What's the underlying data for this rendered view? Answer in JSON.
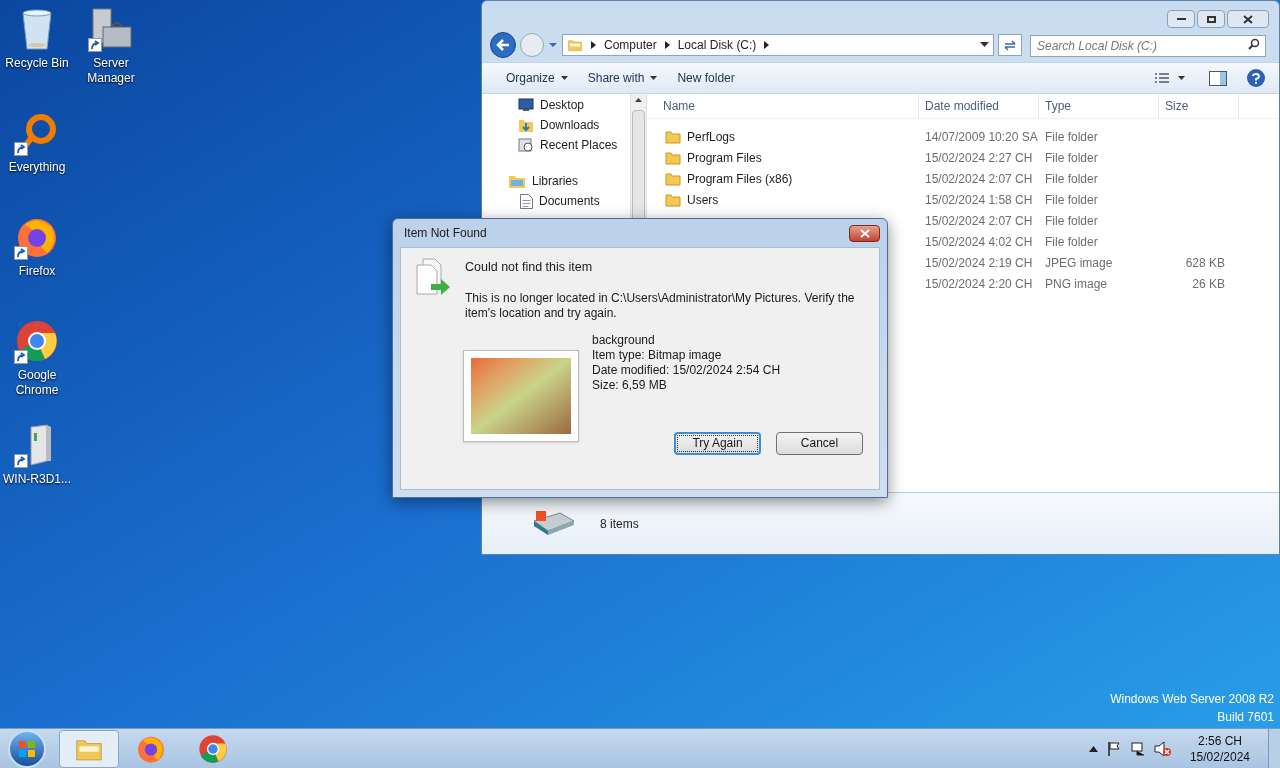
{
  "desktop_icons": [
    {
      "label": "Recycle Bin",
      "kind": "bin",
      "shortcut": false
    },
    {
      "label": "Server Manager",
      "kind": "server",
      "shortcut": true
    },
    {
      "label": "Everything",
      "kind": "everything",
      "shortcut": true
    },
    {
      "label": "Firefox",
      "kind": "firefox",
      "shortcut": true
    },
    {
      "label": "Google Chrome",
      "kind": "chrome",
      "shortcut": true
    },
    {
      "label": "WIN-R3D1...",
      "kind": "drive",
      "shortcut": true
    }
  ],
  "explorer": {
    "breadcrumbs": [
      "Computer",
      "Local Disk (C:)"
    ],
    "search": {
      "placeholder": "Search Local Disk (C:)"
    },
    "toolbar": [
      {
        "label": "Organize",
        "menu": true
      },
      {
        "label": "Share with",
        "menu": true
      },
      {
        "label": "New folder",
        "menu": false
      }
    ],
    "nav": [
      {
        "label": "Desktop",
        "kind": "desktop"
      },
      {
        "label": "Downloads",
        "kind": "downloads"
      },
      {
        "label": "Recent Places",
        "kind": "recent"
      },
      {
        "label": "Libraries",
        "kind": "libraries",
        "children": [
          {
            "label": "Documents",
            "kind": "documents"
          }
        ]
      }
    ],
    "columns": [
      "Name",
      "Date modified",
      "Type",
      "Size"
    ],
    "rows": [
      {
        "name": "PerfLogs",
        "date": "14/07/2009 10:20 SA",
        "type": "File folder"
      },
      {
        "name": "Program Files",
        "date": "15/02/2024 2:27 CH",
        "type": "File folder"
      },
      {
        "name": "Program Files (x86)",
        "date": "15/02/2024 2:07 CH",
        "type": "File folder"
      },
      {
        "name": "Users",
        "date": "15/02/2024 1:58 CH",
        "type": "File folder"
      },
      {
        "date": "15/02/2024 2:07 CH",
        "type": "File folder"
      },
      {
        "date": "15/02/2024 4:02 CH",
        "type": "File folder"
      },
      {
        "date": "15/02/2024 2:19 CH",
        "type": "JPEG image",
        "size": "628 KB"
      },
      {
        "date": "15/02/2024 2:20 CH",
        "type": "PNG image",
        "size": "26 KB"
      }
    ],
    "status": "8 items"
  },
  "dialog": {
    "title": "Item Not Found",
    "heading": "Could not find this item",
    "message": "This is no longer located in C:\\Users\\Administrator\\My Pictures. Verify the item's location and try again.",
    "file": [
      "background",
      "Item type: Bitmap image",
      "Date modified: 15/02/2024 2:54 CH",
      "Size: 6,59 MB"
    ],
    "buttons": [
      {
        "label": "Try Again",
        "default": true
      },
      {
        "label": "Cancel",
        "default": false
      }
    ]
  },
  "os_info": [
    "Windows Web Server 2008 R2",
    "Build 7601"
  ],
  "taskbar": {
    "apps": [
      {
        "kind": "explorer",
        "active": true
      },
      {
        "kind": "firefox",
        "active": false
      },
      {
        "kind": "chrome",
        "active": false
      }
    ],
    "clock": {
      "time": "2:56 CH",
      "date": "15/02/2024"
    }
  }
}
